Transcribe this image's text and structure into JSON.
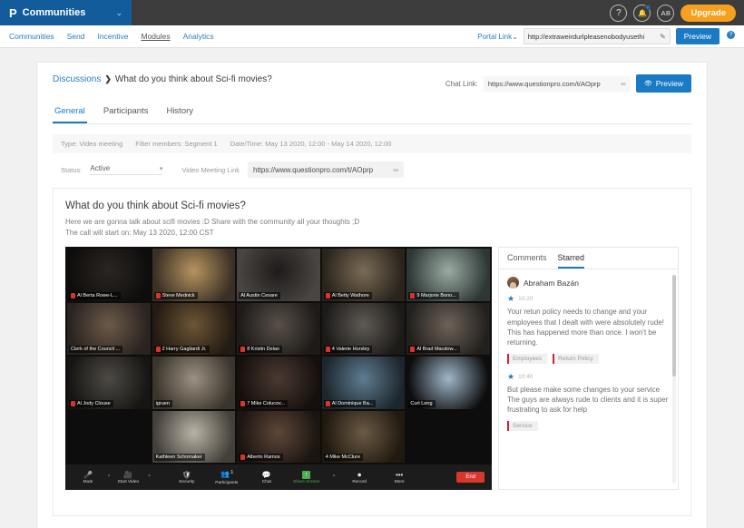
{
  "topbar": {
    "brand_logo": "P",
    "brand_label": "Communities",
    "brand_caret": "⌄",
    "help_icon": "?",
    "bell_icon": "🔔",
    "avatar_initials": "AB",
    "upgrade_label": "Upgrade"
  },
  "navbar": {
    "links": [
      {
        "label": "Communities",
        "active": false
      },
      {
        "label": "Send",
        "active": false
      },
      {
        "label": "Incentive",
        "active": false
      },
      {
        "label": "Modules",
        "active": true
      },
      {
        "label": "Analytics",
        "active": false
      }
    ],
    "portal_link_label": "Portal Link",
    "portal_link_caret": "⌄",
    "portal_url": "http://extraweirdurlpleasenobodyusethi",
    "edit_icon": "✎",
    "preview_label": "Preview",
    "help_badge": "?"
  },
  "breadcrumb": {
    "parent": "Discussions",
    "separator": "❯",
    "current": "What do you think about Sci-fi movies?"
  },
  "chat_link": {
    "label": "Chat Link:",
    "url": "https://www.questionpro.com/t/AOprp",
    "link_icon": "∞",
    "preview_label": "Preview",
    "preview_icon": "👁"
  },
  "tabs": [
    {
      "label": "General",
      "active": true
    },
    {
      "label": "Participants",
      "active": false
    },
    {
      "label": "History",
      "active": false
    }
  ],
  "info_strip": [
    "Type: Video meeting",
    "Filter members: Segment 1",
    "Date/Time: May 13 2020, 12:00 - May 14 2020, 12:00"
  ],
  "status_row": {
    "status_label": "Status:",
    "status_value": "Active",
    "status_caret": "▾",
    "meeting_link_label": "Video Meeting Link",
    "meeting_url": "https://www.questionpro.com/t/AOprp",
    "link_icon": "∞"
  },
  "post": {
    "title": "What do you think about Sci-fi movies?",
    "description_line1": "Here we are gonna talk about scifi movies :D Share with the community all your thoughts ;D",
    "description_line2": "The call will start on: May 13 2020, 12:00 CST"
  },
  "meeting": {
    "tiles": [
      {
        "name": "Al Berta Rowe-L...",
        "muted": true,
        "active": false,
        "empty": false,
        "bg": "#2a2622",
        "bg2": "#0f0d0c"
      },
      {
        "name": "Steve Mednick",
        "muted": true,
        "active": false,
        "empty": false,
        "bg": "#b6935f",
        "bg2": "#3a3025"
      },
      {
        "name": "Al Austin Cesare",
        "muted": false,
        "active": false,
        "empty": false,
        "bg": "#1d1b1a",
        "bg2": "#4a4542"
      },
      {
        "name": "",
        "muted": false,
        "active": false,
        "empty": true,
        "bg": "#0d0d0d",
        "bg2": "#0d0d0d"
      },
      {
        "name": "",
        "muted": false,
        "active": false,
        "empty": true,
        "bg": "#0d0d0d",
        "bg2": "#0d0d0d"
      },
      {
        "name": "Clerk of the Council ...",
        "muted": false,
        "active": false,
        "empty": false,
        "bg": "#6b5a49",
        "bg2": "#2a2320"
      },
      {
        "name": "2 Harry Gagliardi Jr.",
        "muted": true,
        "active": false,
        "empty": false,
        "bg": "#6d5536",
        "bg2": "#231b12"
      },
      {
        "name": "8 Kristin Dolan",
        "muted": true,
        "active": false,
        "empty": false,
        "bg": "#585049",
        "bg2": "#1d1a17"
      },
      {
        "name": "",
        "muted": false,
        "active": false,
        "empty": true,
        "bg": "#0d0d0d",
        "bg2": "#0d0d0d"
      },
      {
        "name": "",
        "muted": false,
        "active": false,
        "empty": true,
        "bg": "#0d0d0d",
        "bg2": "#0d0d0d"
      },
      {
        "name": "Al Jody Clouse",
        "muted": true,
        "active": false,
        "empty": false,
        "bg": "#4d4a45",
        "bg2": "#171513"
      },
      {
        "name": "igruen",
        "muted": false,
        "active": false,
        "empty": false,
        "bg": "#9c9183",
        "bg2": "#3a342c"
      },
      {
        "name": "7 Mike Colucov...",
        "muted": true,
        "active": false,
        "empty": false,
        "bg": "#4a3a32",
        "bg2": "#16100d"
      },
      {
        "name": "",
        "muted": false,
        "active": false,
        "empty": true,
        "bg": "#0d0d0d",
        "bg2": "#0d0d0d"
      },
      {
        "name": "",
        "muted": false,
        "active": false,
        "empty": true,
        "bg": "#0d0d0d",
        "bg2": "#0d0d0d"
      },
      {
        "name": "",
        "muted": false,
        "active": false,
        "empty": true,
        "bg": "#0d0d0d",
        "bg2": "#0d0d0d"
      },
      {
        "name": "Kathleen Schomaker",
        "muted": false,
        "active": false,
        "empty": false,
        "bg": "#b9b3a6",
        "bg2": "#43403a"
      },
      {
        "name": "Alberto Ramos",
        "muted": true,
        "active": false,
        "empty": false,
        "bg": "#5d4738",
        "bg2": "#1b1411"
      },
      {
        "name": "",
        "muted": false,
        "active": false,
        "empty": true,
        "bg": "#0d0d0d",
        "bg2": "#0d0d0d"
      },
      {
        "name": "",
        "muted": false,
        "active": false,
        "empty": true,
        "bg": "#0d0d0d",
        "bg2": "#0d0d0d"
      }
    ],
    "row2_extra": [
      {
        "name": "Al Betty Wathore",
        "muted": true,
        "bg": "#7a6b56",
        "bg2": "#2a241c"
      },
      {
        "name": "9 Marjorie Bono...",
        "muted": true,
        "bg": "#9aaca4",
        "bg2": "#2e3734"
      },
      {
        "name": "4 Valerie Horsley",
        "muted": true,
        "bg": "#5f5a54",
        "bg2": "#1c1a18"
      },
      {
        "name": "Al Brad Macdow...",
        "muted": true,
        "bg": "#6d6258",
        "bg2": "#22201d"
      },
      {
        "name": "Al Dominique Ba...",
        "muted": true,
        "bg": "#5e7c91",
        "bg2": "#1d262c"
      },
      {
        "name": "Curt Leng",
        "muted": false,
        "bg": "#9fb6c9",
        "bg2": "#0d0d0d"
      },
      {
        "name": "4 Mike McClure",
        "muted": false,
        "bg": "#6b5a45",
        "bg2": "#20190f"
      }
    ],
    "toolbar": {
      "mute_label": "Mute",
      "mute_icon": "🎤",
      "video_label": "Start Video",
      "video_icon": "📹",
      "security_label": "Security",
      "security_icon": "🛡",
      "participants_label": "Participants",
      "participants_icon": "👥",
      "participants_count": "1",
      "chat_label": "Chat",
      "chat_icon": "💬",
      "share_label": "Share Screen",
      "share_icon": "↑",
      "record_label": "Record",
      "record_icon": "⏺",
      "more_label": "More",
      "more_icon": "•••",
      "end_label": "End",
      "caret": "^"
    }
  },
  "comments": {
    "tabs": [
      {
        "label": "Comments",
        "active": false
      },
      {
        "label": "Starred",
        "active": true
      }
    ],
    "items": [
      {
        "author": "Abraham Bazán",
        "time": "10:20",
        "star": "★",
        "text": "Your retun policy needs to change and your employees that I dealt with were absolutely rude! This has happened more than once. I won't be returning.",
        "tags": [
          "Employees",
          "Return Policy"
        ]
      },
      {
        "author": "",
        "time": "10:40",
        "star": "★",
        "text": "But please make some changes to your service The guys are always rude to clients and it is super frustrating to ask for help",
        "tags": [
          "Service"
        ]
      }
    ]
  },
  "colors": {
    "brand_blue": "#135c9b",
    "accent_blue": "#1b7ac4",
    "upgrade_orange": "#f7a01e",
    "tag_red": "#cf2231",
    "end_red": "#d8372c",
    "share_green": "#4caf50",
    "active_speaker": "#d6e85a"
  }
}
